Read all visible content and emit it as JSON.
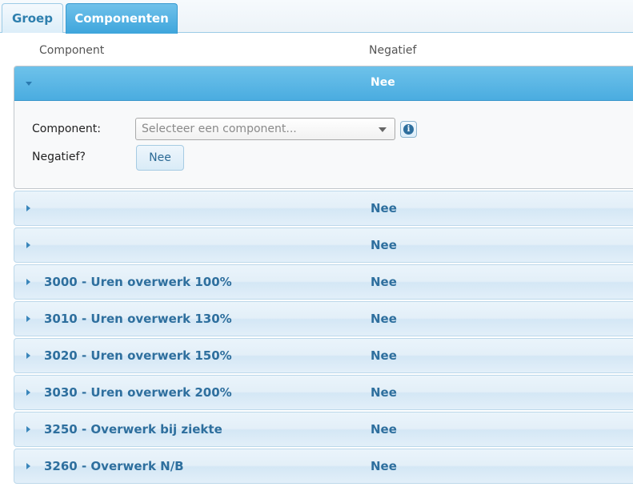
{
  "tabs": [
    {
      "label": "Groep"
    },
    {
      "label": "Componenten"
    }
  ],
  "columns": {
    "component": "Component",
    "negatief": "Negatief"
  },
  "expanded_row": {
    "negatief": "Nee",
    "component_label": "Component:",
    "component_placeholder": "Selecteer een component...",
    "negatief_label": "Negatief?",
    "negatief_toggle": "Nee"
  },
  "rows": [
    {
      "component": "",
      "negatief": "Nee"
    },
    {
      "component": "",
      "negatief": "Nee"
    },
    {
      "component": "3000 - Uren overwerk 100%",
      "negatief": "Nee"
    },
    {
      "component": "3010 - Uren overwerk 130%",
      "negatief": "Nee"
    },
    {
      "component": "3020 - Uren overwerk 150%",
      "negatief": "Nee"
    },
    {
      "component": "3030 - Uren overwerk 200%",
      "negatief": "Nee"
    },
    {
      "component": "3250 - Overwerk bij ziekte",
      "negatief": "Nee"
    },
    {
      "component": "3260 - Overwerk N/B",
      "negatief": "Nee"
    }
  ],
  "icons": {
    "expanded_arrow": "chevron-down-icon",
    "row_arrow": "chevron-right-icon",
    "select_arrow": "caret-down-icon",
    "info": "info-icon"
  }
}
